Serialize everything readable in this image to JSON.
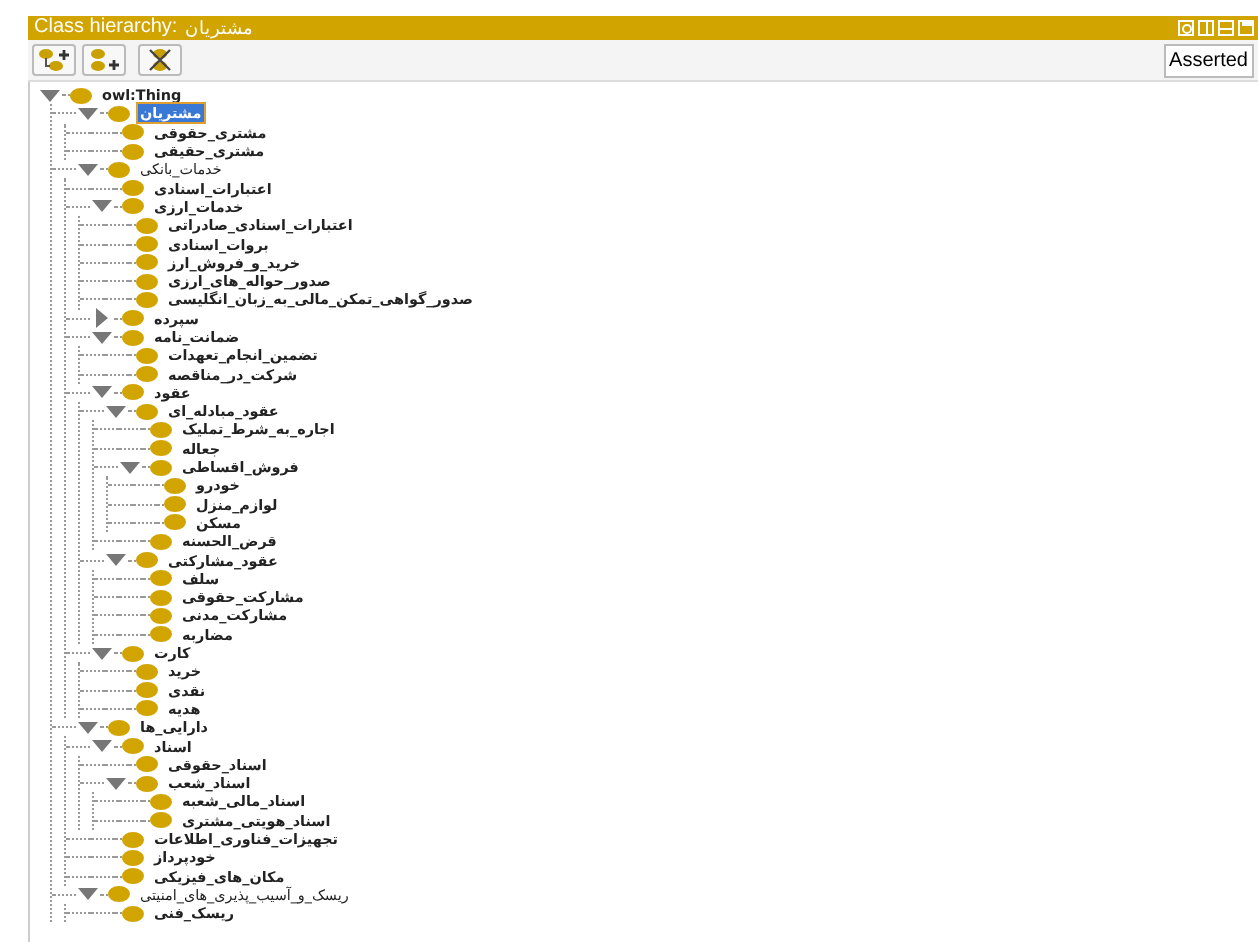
{
  "title_bar": {
    "title": "Class hierarchy:",
    "selected_class": "مشتریان"
  },
  "toolbar": {
    "view_mode": "Asserted"
  },
  "tree": {
    "label": "owl:Thing",
    "bold": true,
    "selected": false,
    "expanded": true,
    "children": [
      {
        "label": "مشتریان",
        "bold": true,
        "selected": true,
        "expanded": true,
        "children": [
          {
            "label": "مشتری_حقوقی",
            "bold": true,
            "selected": false
          },
          {
            "label": "مشتری_حقیقی",
            "bold": true,
            "selected": false
          }
        ]
      },
      {
        "label": "خدمات_بانکی",
        "bold": false,
        "selected": false,
        "expanded": true,
        "children": [
          {
            "label": "اعتبارات_اسنادی",
            "bold": true,
            "selected": false
          },
          {
            "label": "خدمات_ارزی",
            "bold": true,
            "selected": false,
            "expanded": true,
            "children": [
              {
                "label": "اعتبارات_اسنادی_صادراتی",
                "bold": true,
                "selected": false
              },
              {
                "label": "بروات_اسنادی",
                "bold": true,
                "selected": false
              },
              {
                "label": "خرید_و_فروش_ارز",
                "bold": true,
                "selected": false
              },
              {
                "label": "صدور_حواله_های_ارزی",
                "bold": true,
                "selected": false
              },
              {
                "label": "صدور_گواهی_تمکن_مالی_به_زبان_انگلیسی",
                "bold": true,
                "selected": false
              }
            ]
          },
          {
            "label": "سپرده",
            "bold": true,
            "selected": false,
            "expanded": false
          },
          {
            "label": "ضمانت_نامه",
            "bold": true,
            "selected": false,
            "expanded": true,
            "children": [
              {
                "label": "تضمین_انجام_تعهدات",
                "bold": true,
                "selected": false
              },
              {
                "label": "شرکت_در_مناقصه",
                "bold": true,
                "selected": false
              }
            ]
          },
          {
            "label": "عقود",
            "bold": true,
            "selected": false,
            "expanded": true,
            "children": [
              {
                "label": "عقود_مبادله_ای",
                "bold": true,
                "selected": false,
                "expanded": true,
                "children": [
                  {
                    "label": "اجاره_به_شرط_تملیک",
                    "bold": true,
                    "selected": false
                  },
                  {
                    "label": "جعاله",
                    "bold": true,
                    "selected": false
                  },
                  {
                    "label": "فروش_اقساطی",
                    "bold": true,
                    "selected": false,
                    "expanded": true,
                    "children": [
                      {
                        "label": "خودرو",
                        "bold": true,
                        "selected": false
                      },
                      {
                        "label": "لوازم_منزل",
                        "bold": true,
                        "selected": false
                      },
                      {
                        "label": "مسکن",
                        "bold": true,
                        "selected": false
                      }
                    ]
                  },
                  {
                    "label": "قرض_الحسنه",
                    "bold": true,
                    "selected": false
                  }
                ]
              },
              {
                "label": "عقود_مشارکتی",
                "bold": true,
                "selected": false,
                "expanded": true,
                "children": [
                  {
                    "label": "سلف",
                    "bold": true,
                    "selected": false
                  },
                  {
                    "label": "مشارکت_حقوقی",
                    "bold": true,
                    "selected": false
                  },
                  {
                    "label": "مشارکت_مدنی",
                    "bold": true,
                    "selected": false
                  },
                  {
                    "label": "مضاربه",
                    "bold": true,
                    "selected": false
                  }
                ]
              }
            ]
          },
          {
            "label": "کارت",
            "bold": true,
            "selected": false,
            "expanded": true,
            "children": [
              {
                "label": "خرید",
                "bold": true,
                "selected": false
              },
              {
                "label": "نقدی",
                "bold": true,
                "selected": false
              },
              {
                "label": "هدیه",
                "bold": true,
                "selected": false
              }
            ]
          }
        ]
      },
      {
        "label": "دارایی_ها",
        "bold": true,
        "selected": false,
        "expanded": true,
        "children": [
          {
            "label": "اسناد",
            "bold": true,
            "selected": false,
            "expanded": true,
            "children": [
              {
                "label": "اسناد_حقوقی",
                "bold": true,
                "selected": false
              },
              {
                "label": "اسناد_شعب",
                "bold": true,
                "selected": false,
                "expanded": true,
                "children": [
                  {
                    "label": "اسناد_مالی_شعبه",
                    "bold": true,
                    "selected": false
                  },
                  {
                    "label": "اسناد_هویتی_مشتری",
                    "bold": true,
                    "selected": false
                  }
                ]
              }
            ]
          },
          {
            "label": "تجهیزات_فناوری_اطلاعات",
            "bold": true,
            "selected": false
          },
          {
            "label": "خودپرداز",
            "bold": true,
            "selected": false
          },
          {
            "label": "مکان_های_فیزیکی",
            "bold": true,
            "selected": false
          }
        ]
      },
      {
        "label": "ریسک_و_آسیب_پذیری_های_امنیتی",
        "bold": false,
        "selected": false,
        "expanded": true,
        "children": [
          {
            "label": "ریسک_فنی",
            "bold": true,
            "selected": false
          }
        ]
      }
    ]
  }
}
